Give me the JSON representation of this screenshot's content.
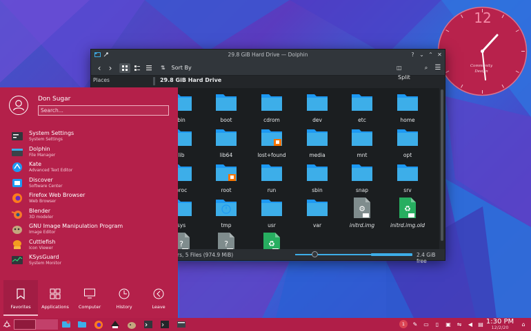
{
  "window": {
    "title": "29.8 GiB Hard Drive — Dolphin",
    "toolbar": {
      "sort_label": "Sort By",
      "split_label": "Split"
    },
    "places_label": "Places",
    "breadcrumb": "29.8 GiB Hard Drive",
    "status_text": "rs, 5 Files (974.9 MiB)",
    "free_space": "2.4 GiB free",
    "files": [
      {
        "name": "bin",
        "type": "folder"
      },
      {
        "name": "boot",
        "type": "folder"
      },
      {
        "name": "cdrom",
        "type": "folder"
      },
      {
        "name": "dev",
        "type": "folder"
      },
      {
        "name": "etc",
        "type": "folder"
      },
      {
        "name": "home",
        "type": "folder"
      },
      {
        "name": "lib",
        "type": "folder"
      },
      {
        "name": "lib64",
        "type": "folder"
      },
      {
        "name": "lost+found",
        "type": "folder-locked"
      },
      {
        "name": "media",
        "type": "folder"
      },
      {
        "name": "mnt",
        "type": "folder"
      },
      {
        "name": "opt",
        "type": "folder"
      },
      {
        "name": "proc",
        "type": "folder"
      },
      {
        "name": "root",
        "type": "folder-locked"
      },
      {
        "name": "run",
        "type": "folder"
      },
      {
        "name": "sbin",
        "type": "folder"
      },
      {
        "name": "snap",
        "type": "folder"
      },
      {
        "name": "srv",
        "type": "folder"
      },
      {
        "name": "sys",
        "type": "folder"
      },
      {
        "name": "tmp",
        "type": "folder-clock"
      },
      {
        "name": "usr",
        "type": "folder"
      },
      {
        "name": "var",
        "type": "folder"
      },
      {
        "name": "initrd.img",
        "type": "link-gray"
      },
      {
        "name": "initrd.img.old",
        "type": "link-green"
      },
      {
        "name": "",
        "type": "unknown-gray"
      },
      {
        "name": "",
        "type": "unknown-gray"
      },
      {
        "name": "",
        "type": "link-green"
      }
    ]
  },
  "launcher": {
    "user_name": "Don Sugar",
    "search_placeholder": "Search...",
    "apps": [
      {
        "name": "System Settings",
        "desc": "System Settings",
        "icon": "settings-icon"
      },
      {
        "name": "Dolphin",
        "desc": "File Manager",
        "icon": "dolphin-icon"
      },
      {
        "name": "Kate",
        "desc": "Advanced Text Editor",
        "icon": "kate-icon"
      },
      {
        "name": "Discover",
        "desc": "Software Center",
        "icon": "discover-icon"
      },
      {
        "name": "Firefox Web Browser",
        "desc": "Web Browser",
        "icon": "firefox-icon"
      },
      {
        "name": "Blender",
        "desc": "3D modeler",
        "icon": "blender-icon"
      },
      {
        "name": "GNU Image Manipulation Program",
        "desc": "Image Editor",
        "icon": "gimp-icon"
      },
      {
        "name": "Cuttlefish",
        "desc": "Icon Viewer",
        "icon": "cuttlefish-icon"
      },
      {
        "name": "KSysGuard",
        "desc": "System Monitor",
        "icon": "ksysguard-icon"
      }
    ],
    "tabs": [
      {
        "label": "Favorites",
        "icon": "bookmark-icon"
      },
      {
        "label": "Applications",
        "icon": "grid-icon"
      },
      {
        "label": "Computer",
        "icon": "monitor-icon"
      },
      {
        "label": "History",
        "icon": "clock-icon"
      },
      {
        "label": "Leave",
        "icon": "leave-icon"
      }
    ]
  },
  "clock_widget": {
    "twelve": "12",
    "caption": "Community Design"
  },
  "taskbar": {
    "time": "1:30 PM",
    "date": "12/2/20",
    "notification_count": "1"
  },
  "colors": {
    "accent": "#b4204a",
    "folder": "#3daee9",
    "window_bg": "#232629"
  }
}
